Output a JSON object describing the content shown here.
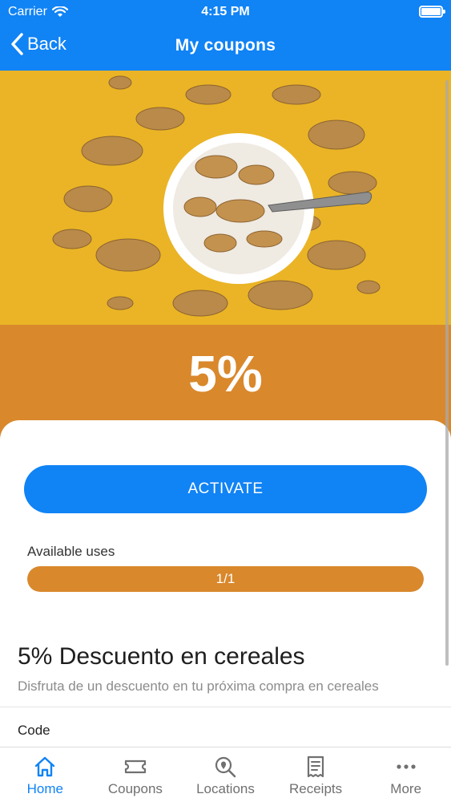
{
  "status_bar": {
    "carrier": "Carrier",
    "time": "4:15 PM"
  },
  "nav": {
    "back_label": "Back",
    "title": "My coupons"
  },
  "hero": {
    "image": "cereal-bowl-photo"
  },
  "coupon": {
    "discount": "5%",
    "activate_label": "ACTIVATE",
    "available_uses_label": "Available uses",
    "uses_text": "1/1",
    "uses_fraction": 1.0,
    "title": "5% Descuento en cereales",
    "description": "Disfruta de un descuento en tu próxima compra en cereales",
    "code_label": "Code"
  },
  "tabs": [
    {
      "label": "Home",
      "icon": "home-icon",
      "active": true
    },
    {
      "label": "Coupons",
      "icon": "ticket-icon",
      "active": false
    },
    {
      "label": "Locations",
      "icon": "location-search-icon",
      "active": false
    },
    {
      "label": "Receipts",
      "icon": "receipt-icon",
      "active": false
    },
    {
      "label": "More",
      "icon": "more-dots-icon",
      "active": false
    }
  ],
  "colors": {
    "primary": "#1083f5",
    "discount_band": "#d9882c",
    "hero_background": "#eab426"
  }
}
